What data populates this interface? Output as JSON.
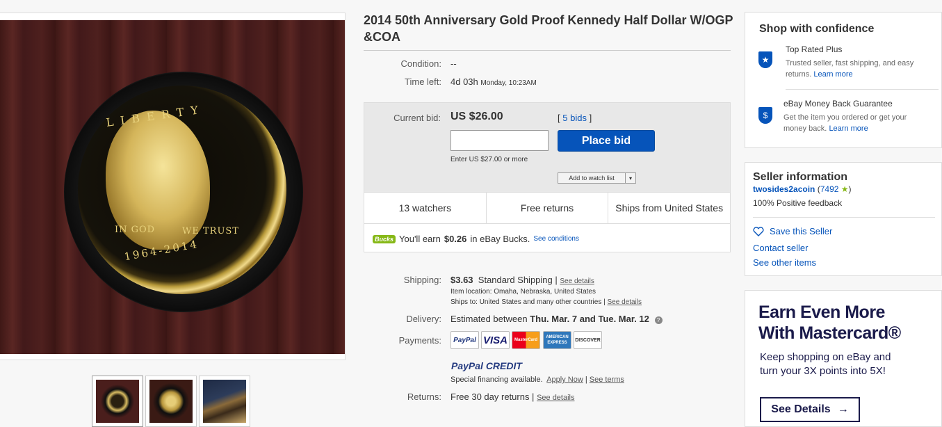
{
  "listing": {
    "title": "2014 50th Anniversary Gold Proof Kennedy Half Dollar W/OGP &COA",
    "condition_label": "Condition:",
    "condition_value": "--",
    "time_left_label": "Time left:",
    "time_left_value": "4d 03h",
    "time_left_end": "Monday, 10:23AM"
  },
  "coin_image": {
    "liberty": "LIBERTY",
    "in_god": "IN GOD",
    "we_trust": "WE TRUST",
    "dates": "1964-2014"
  },
  "bid": {
    "current_bid_label": "Current bid:",
    "current_bid_value": "US $26.00",
    "bids_link": "5 bids",
    "bids_open": "[",
    "bids_close": "]",
    "input_value": "",
    "place_bid_label": "Place bid",
    "enter_hint": "Enter US $27.00 or more",
    "watch_label": "Add to watch list",
    "watch_arrow": "▾"
  },
  "stats": [
    "13 watchers",
    "Free returns",
    "Ships from United States"
  ],
  "bucks": {
    "logo": "Bucks",
    "pre": "You'll earn",
    "amount": "$0.26",
    "post": "in eBay Bucks.",
    "link": "See conditions"
  },
  "shipping": {
    "label": "Shipping:",
    "price": "$3.63",
    "method": "Standard Shipping |",
    "details_link": "See details",
    "location": "Item location:  Omaha, Nebraska, United States",
    "ships_to": "Ships to:  United States and many other countries |",
    "ships_to_link": "See details"
  },
  "delivery": {
    "label": "Delivery:",
    "pre": "Estimated between",
    "dates": "Thu. Mar. 7 and Tue. Mar. 12",
    "help": "?"
  },
  "payments": {
    "label": "Payments:",
    "logos": [
      "PayPal",
      "VISA",
      "MasterCard",
      "AMERICAN EXPRESS",
      "DISCOVER"
    ],
    "paypal_credit": "PayPal CREDIT",
    "financing": "Special financing available.",
    "apply_link": "Apply Now",
    "sep": "|",
    "terms_link": "See terms"
  },
  "returns": {
    "label": "Returns:",
    "value": "Free 30 day returns |",
    "link": "See details"
  },
  "confidence": {
    "title": "Shop with confidence",
    "top_rated_title": "Top Rated Plus",
    "top_rated_desc": "Trusted seller, fast shipping, and easy returns.",
    "top_rated_link": "Learn more",
    "mbg_title": "eBay Money Back Guarantee",
    "mbg_desc": "Get the item you ordered or get your money back.",
    "mbg_link": "Learn more",
    "mbg_icon": "$"
  },
  "seller": {
    "title": "Seller information",
    "name": "twosides2acoin",
    "score_open": "(",
    "score": "7492",
    "score_close": ")",
    "star": "★",
    "feedback": "100% Positive feedback",
    "save": "Save this Seller",
    "contact": "Contact seller",
    "other": "See other items"
  },
  "ad": {
    "line1": "Earn Even More",
    "line2": "With Mastercard®",
    "body1": "Keep shopping on eBay and",
    "body2": "turn your 3X points into 5X!",
    "button": "See Details",
    "arrow": "→"
  },
  "colors": {
    "link": "#0654ba",
    "button": "#0654ba",
    "bucks_green": "#86b817",
    "ad_navy": "#1a1a4a"
  }
}
